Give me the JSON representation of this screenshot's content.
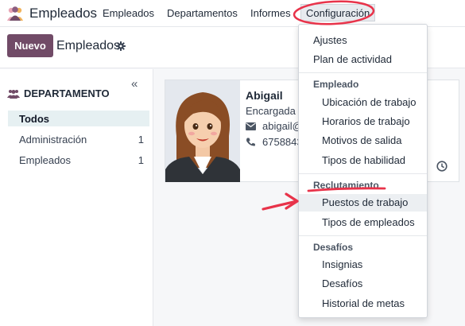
{
  "nav": {
    "app_name": "Empleados",
    "items": [
      "Empleados",
      "Departamentos",
      "Informes",
      "Configuración"
    ]
  },
  "control": {
    "new_label": "Nuevo",
    "breadcrumb": "Empleados"
  },
  "sidebar": {
    "heading": "DEPARTAMENTO",
    "rows": [
      {
        "label": "Todos",
        "count": ""
      },
      {
        "label": "Administración",
        "count": "1"
      },
      {
        "label": "Empleados",
        "count": "1"
      }
    ]
  },
  "card": {
    "name": "Abigail",
    "job": "Encargada c",
    "email": "abigail@",
    "phone": "6758843"
  },
  "menu": {
    "ajustes": "Ajustes",
    "plan": "Plan de actividad",
    "sec_empleado": "Empleado",
    "ubicacion": "Ubicación de trabajo",
    "horarios": "Horarios de trabajo",
    "motivos": "Motivos de salida",
    "habilidad": "Tipos de habilidad",
    "sec_reclutamiento": "Reclutamiento",
    "puestos": "Puestos de trabajo",
    "tipos_empleados": "Tipos de empleados",
    "sec_desafios": "Desafíos",
    "insignias": "Insignias",
    "desafios": "Desafíos",
    "historial": "Historial de metas"
  },
  "colors": {
    "brand": "#714b67",
    "annotation": "#e8334a",
    "active_row": "#e6f0f2"
  }
}
